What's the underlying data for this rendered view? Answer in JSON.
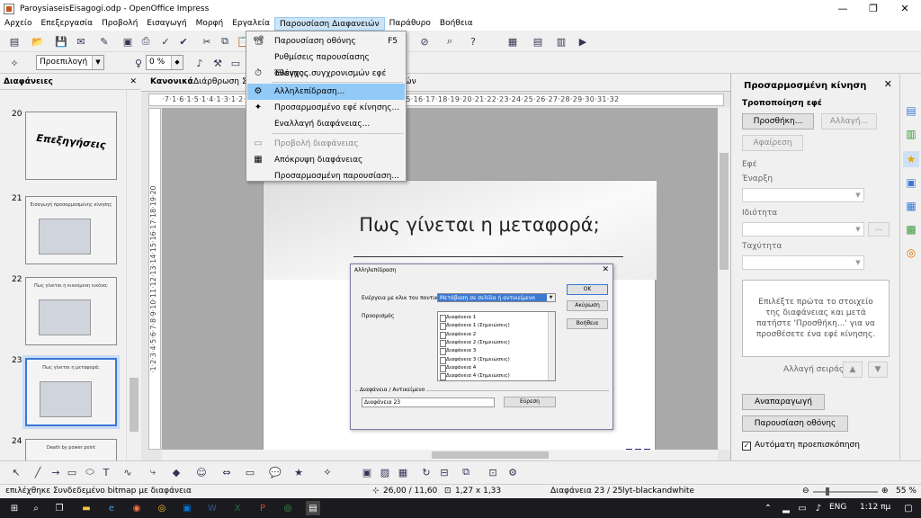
{
  "window": {
    "title": "ParoysiaseisEisagogi.odp - OpenOffice Impress",
    "min_glyph": "—",
    "max_glyph": "❐",
    "close_glyph": "✕"
  },
  "menubar": {
    "items": [
      "Αρχείο",
      "Επεξεργασία",
      "Προβολή",
      "Εισαγωγή",
      "Μορφή",
      "Εργαλεία",
      "Παρουσίαση Διαφανειών",
      "Παράθυρο",
      "Βοήθεια"
    ],
    "open_index": 6
  },
  "toolbar2": {
    "line_style": "Προεπιλογή",
    "percent": "0 %"
  },
  "slides_panel": {
    "title": "Διαφάνειες",
    "close": "✕",
    "slides": [
      {
        "number": "20",
        "text": "Επεξηγήσεις"
      },
      {
        "number": "21",
        "text": "Εισαγωγή προσαρμοσμένης κίνησης"
      },
      {
        "number": "22",
        "text": "Πως γίνεται η κινούμενη εικόνα;"
      },
      {
        "number": "23",
        "text": "Πως γίνεται η μεταφορά;"
      },
      {
        "number": "24",
        "text": "Death by power point"
      }
    ],
    "selected_index": 3
  },
  "tabs": {
    "items": [
      "Κανονικά",
      "Διάρθρωση",
      "Σ",
      "ιών"
    ],
    "active_index": 0
  },
  "ruler": {
    "h": "·7·1·6·1·5·1·4·1·3·1·2·1·1·1·  ·1·2·3·4·5·6·7·8·9·10·11·12·13·14·15·16·17·18·19·20·21·22·23·24·25·26·27·28·29·30·31·32",
    "v": "·1·2·3·4·5·6·7·8·9·10·11·12·13·14·15·16·17·18·19·20"
  },
  "slide": {
    "title": "Πως γίνεται η μεταφορά;"
  },
  "dropdown_menu": {
    "items": [
      {
        "label": "Παρουσίαση οθόνης",
        "shortcut": "F5",
        "icon": "📽",
        "disabled": false,
        "highlight": false
      },
      {
        "label": "Ρυθμίσεις παρουσίασης οθόνης...",
        "shortcut": "",
        "icon": "",
        "disabled": false,
        "highlight": false
      },
      {
        "label": "Έλεγχος συγχρονισμών εφέ",
        "shortcut": "",
        "icon": "⏱",
        "disabled": false,
        "highlight": false
      },
      {
        "label": "Αλληλεπίδραση...",
        "shortcut": "",
        "icon": "⚙",
        "disabled": false,
        "highlight": true
      },
      {
        "label": "Προσαρμοσμένο εφέ κίνησης...",
        "shortcut": "",
        "icon": "✦",
        "disabled": false,
        "highlight": false
      },
      {
        "label": "Εναλλαγή διαφάνειας...",
        "shortcut": "",
        "icon": "",
        "disabled": false,
        "highlight": false
      },
      {
        "label": "Προβολή διαφάνειας",
        "shortcut": "",
        "icon": "▭",
        "disabled": true,
        "highlight": false
      },
      {
        "label": "Απόκρυψη διαφάνειας",
        "shortcut": "",
        "icon": "▦",
        "disabled": false,
        "highlight": false
      },
      {
        "label": "Προσαρμοσμένη παρουσίαση...",
        "shortcut": "",
        "icon": "",
        "disabled": false,
        "highlight": false
      }
    ]
  },
  "dialog": {
    "title": "Αλληλεπίδραση",
    "close": "✕",
    "action_label": "Ενέργεια με κλικ του ποντικιού",
    "action_value": "Μετάβαση σε σελίδα ή αντικείμενο",
    "target_label": "Προορισμός",
    "targets": [
      "Διαφάνεια 1",
      "Διαφάνεια 1 (Σημειώσεις)",
      "Διαφάνεια 2",
      "Διαφάνεια 2 (Σημειώσεις)",
      "Διαφάνεια 3",
      "Διαφάνεια 3 (Σημειώσεις)",
      "Διαφάνεια 4",
      "Διαφάνεια 4 (Σημειώσεις)"
    ],
    "ok": "ΟΚ",
    "cancel": "Ακύρωση",
    "help": "Βοήθεια",
    "frame_label": "Διαφάνεια / Αντικείμενο",
    "frame_value": "Διαφάνεια 23",
    "find": "Εύρεση"
  },
  "right_panel": {
    "title": "Προσαρμοσμένη κίνηση",
    "close": "✕",
    "modify_label": "Τροποποίηση εφέ",
    "add": "Προσθήκη...",
    "change": "Αλλαγή...",
    "remove": "Αφαίρεση",
    "effect_label": "Εφέ",
    "start_label": "Έναρξη",
    "property_label": "Ιδιότητα",
    "speed_label": "Ταχύτητα",
    "ellipsis": "...",
    "info": "Επιλέξτε πρώτα το στοιχείο της διαφάνειας και μετά πατήστε 'Προσθήκη...' για να προσθέσετε ένα εφέ κίνησης.",
    "order_label": "Αλλαγή σειράς:",
    "play": "Αναπαραγωγή",
    "slideshow": "Παρουσίαση οθόνης",
    "autopreview": "Αυτόματη προεπισκόπηση",
    "autopreview_checked": true
  },
  "statusbar": {
    "message": "επιλέχθηκε Συνδεδεμένο bitmap με διαφάνεια",
    "position": "26,00 / 11,60",
    "size": "1,27 x 1,33",
    "slide": "Διαφάνεια 23 / 25",
    "layout": "lyt-blackandwhite",
    "zoom": "55 %"
  },
  "taskbar": {
    "language": "ENG",
    "time": "1:12 πμ"
  }
}
